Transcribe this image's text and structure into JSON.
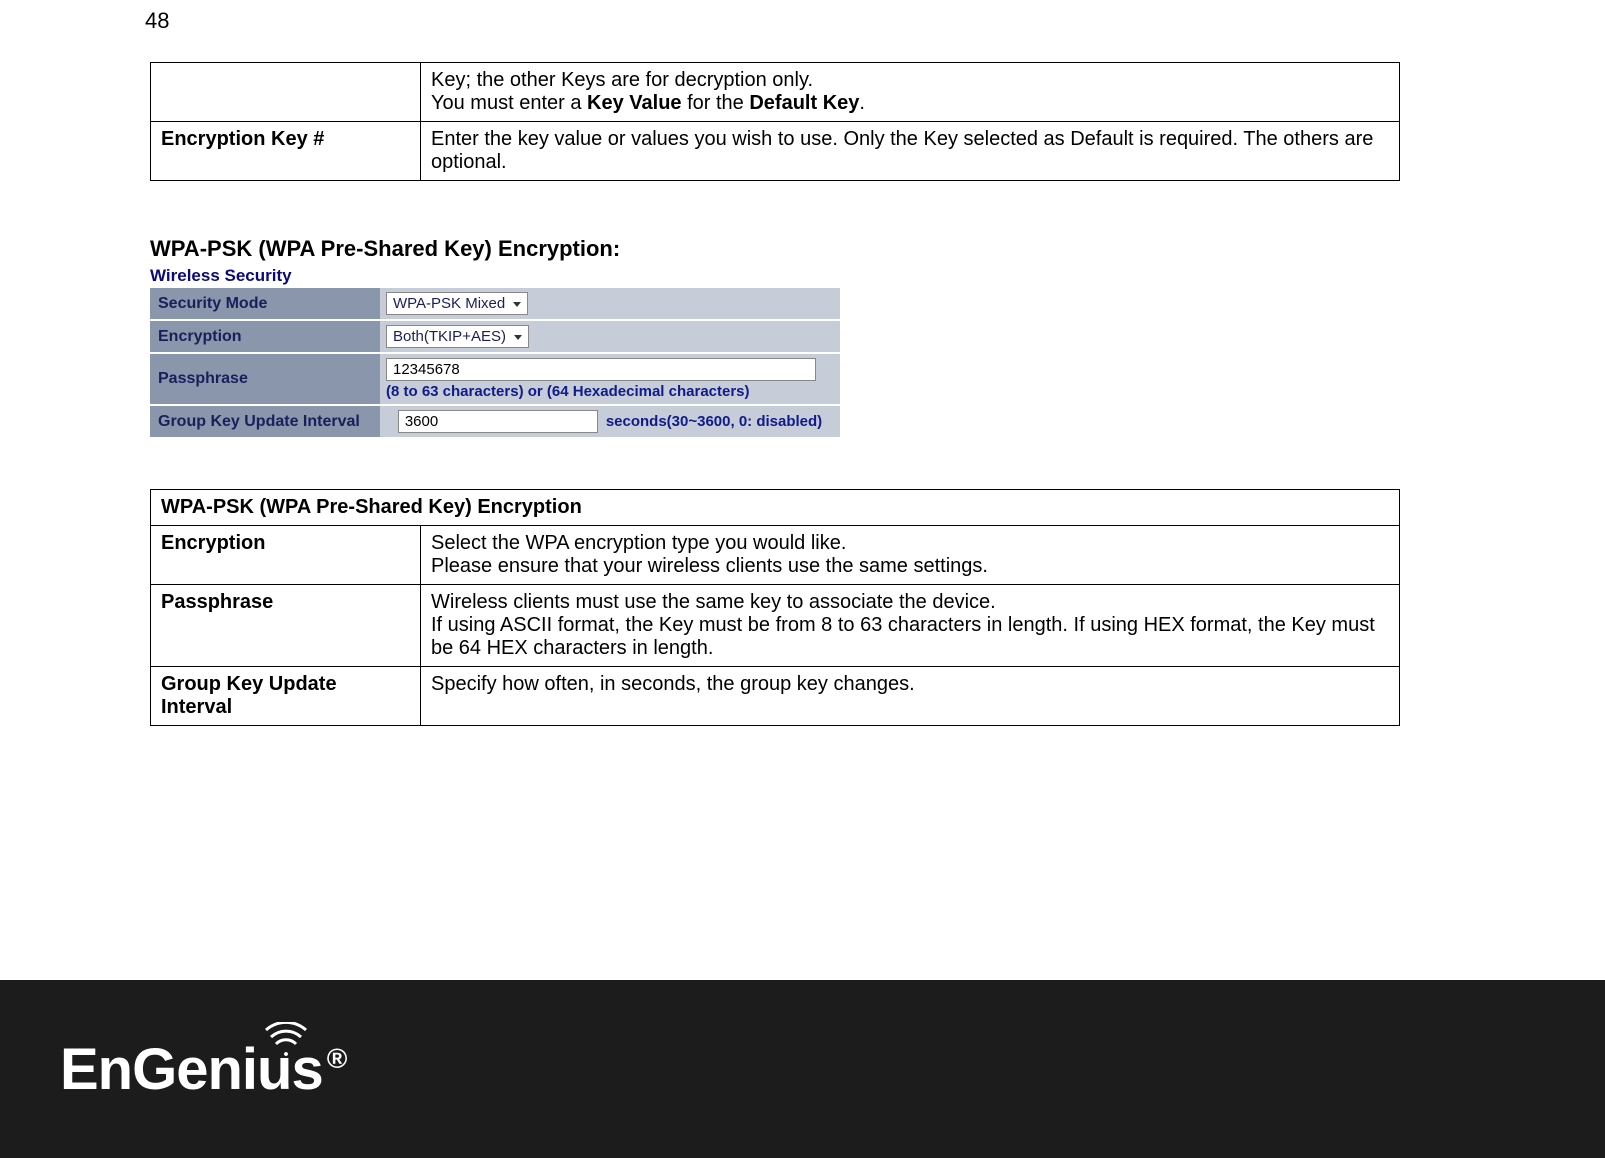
{
  "page_number": "48",
  "table1": {
    "row1_text_part1": "Key; the other Keys are for decryption only.",
    "row1_text_part2": "You must enter a ",
    "row1_bold1": "Key Value",
    "row1_mid": " for the ",
    "row1_bold2": "Default Key",
    "row1_end": ".",
    "row2_label": "Encryption Key #",
    "row2_text": "Enter the key value or values you wish to use. Only the Key selected as Default is required. The others are optional."
  },
  "section_heading": "WPA-PSK (WPA Pre-Shared Key) Encryption:",
  "ws": {
    "title": "Wireless Security",
    "security_mode_label": "Security Mode",
    "security_mode_value": "WPA-PSK Mixed",
    "encryption_label": "Encryption",
    "encryption_value": "Both(TKIP+AES)",
    "passphrase_label": "Passphrase",
    "passphrase_value": "12345678",
    "passphrase_hint": "(8 to 63 characters) or (64 Hexadecimal characters)",
    "gkui_label": "Group Key Update Interval",
    "gkui_value": "3600",
    "gkui_hint": "seconds(30~3600, 0: disabled)"
  },
  "table2": {
    "header": "WPA-PSK (WPA Pre-Shared Key) Encryption",
    "r1_label": "Encryption",
    "r1_line1": "Select the WPA encryption type you would like.",
    "r1_line2": "Please ensure that your wireless clients use the same settings.",
    "r2_label": "Passphrase",
    "r2_line1": "Wireless clients must use the same key to associate the device.",
    "r2_line2": "If using ASCII format, the Key must be from 8 to 63 characters in length. If using HEX format, the Key must be 64 HEX characters in length.",
    "r3_label": "Group Key Update Interval",
    "r3_text": "Specify how often, in seconds, the group key changes."
  },
  "logo": {
    "text": "EnGenius",
    "reg": "®"
  }
}
